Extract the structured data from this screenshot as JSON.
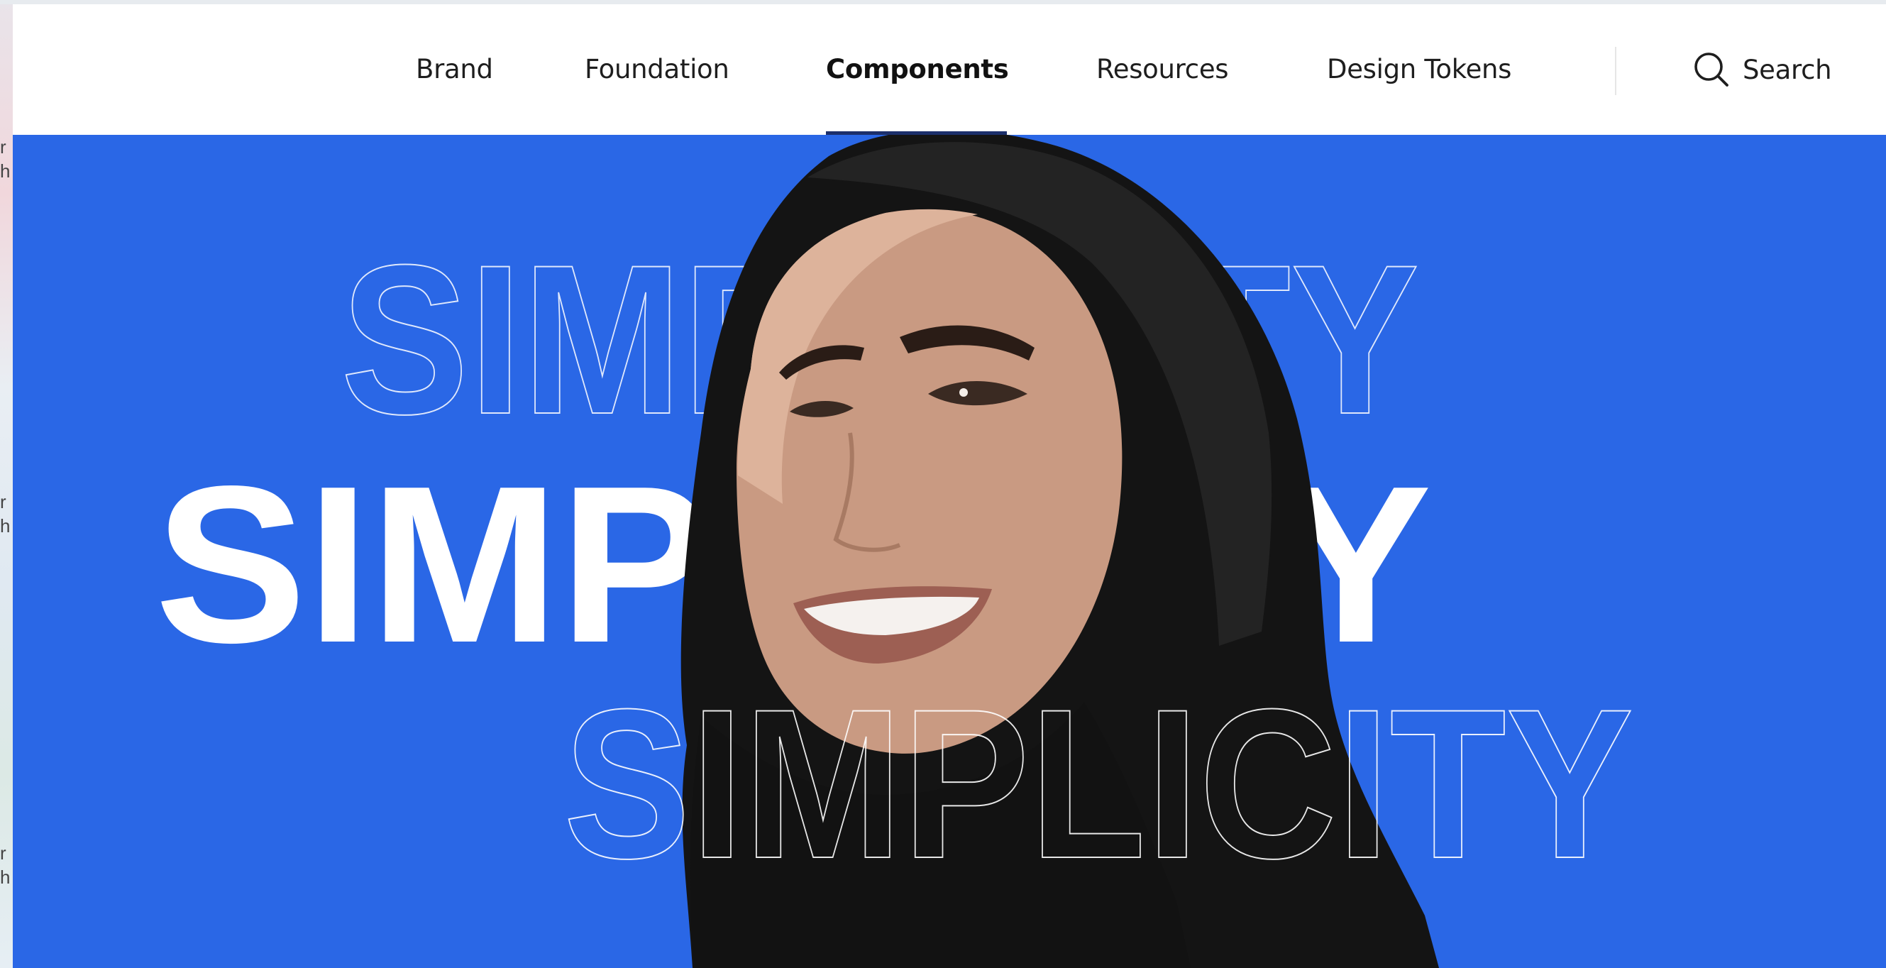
{
  "nav": {
    "items": [
      {
        "label": "Brand"
      },
      {
        "label": "Foundation"
      },
      {
        "label": "Components"
      },
      {
        "label": "Resources"
      },
      {
        "label": "Design Tokens"
      }
    ],
    "active_index": 2,
    "search_label": "Search",
    "search_icon": "search-icon"
  },
  "hero": {
    "words": {
      "top_outline": "SIMPLICITY",
      "middle_solid": "SIMPLICITY",
      "bottom_outline": "SIMPLICITY"
    },
    "image": "smiling-woman-in-black-hijab"
  },
  "colors": {
    "hero_background": "#2a67e6",
    "nav_background": "#ffffff",
    "active_underline": "#1c2f6b",
    "text": "#1e1e1e"
  }
}
